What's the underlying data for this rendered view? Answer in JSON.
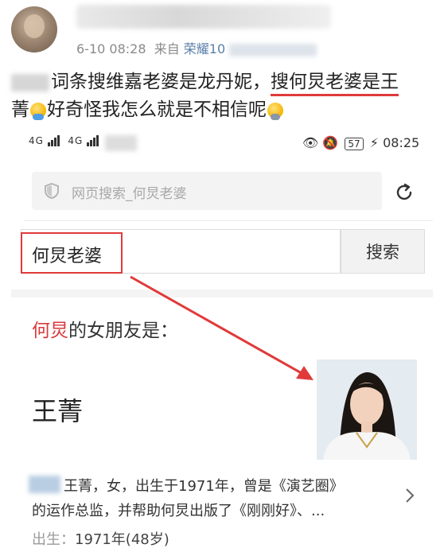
{
  "post": {
    "meta_time": "6-10 08:28",
    "meta_from": "来自",
    "meta_source": "荣耀10",
    "line1_a": "词条搜维嘉老婆是龙丹妮，",
    "line1_b": "搜何炅老婆是王",
    "line2_a": "菁",
    "line2_b": "好奇怪我怎么就是不相信呢",
    "emoji_1": "emoji-hug",
    "emoji_2": "emoji-sweat",
    "accent_color": "#e03a3a"
  },
  "status_bar": {
    "signal_1": "4G",
    "signal_2": "4G",
    "battery": "57",
    "time": "08:25"
  },
  "browser": {
    "address_placeholder": "网页搜索_何炅老婆",
    "reload_icon": "reload-icon",
    "security_icon": "shield-icon"
  },
  "search": {
    "query": "何炅老婆",
    "button_label": "搜索"
  },
  "result": {
    "title_highlight": "何炅",
    "title_rest": "的女朋友是：",
    "answer": "王菁",
    "desc_line1": "王菁，女，出生于1971年，曾是《演艺圈》",
    "desc_line2": "的运作总监，并帮助何炅出版了《刚刚好》、...",
    "birth_label": "出生：",
    "birth_value": "1971年(48岁)",
    "highlight_color": "#d93a3a"
  }
}
